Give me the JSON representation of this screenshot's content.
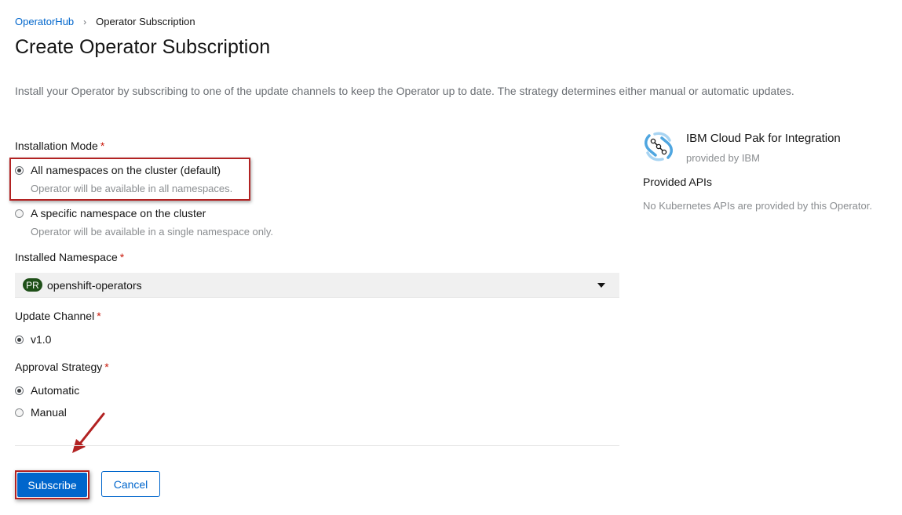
{
  "breadcrumb": {
    "parent": "OperatorHub",
    "separator": "›",
    "current": "Operator Subscription"
  },
  "page_title": "Create Operator Subscription",
  "intro": "Install your Operator by subscribing to one of the update channels to keep the Operator up to date. The strategy determines either manual or automatic updates.",
  "required_mark": "*",
  "installation_mode": {
    "label": "Installation Mode",
    "options": [
      {
        "label": "All namespaces on the cluster (default)",
        "help": "Operator will be available in all namespaces.",
        "checked": true
      },
      {
        "label": "A specific namespace on the cluster",
        "help": "Operator will be available in a single namespace only.",
        "checked": false
      }
    ]
  },
  "installed_namespace": {
    "label": "Installed Namespace",
    "badge": "PR",
    "value": "openshift-operators"
  },
  "update_channel": {
    "label": "Update Channel",
    "options": [
      {
        "label": "v1.0",
        "checked": true
      }
    ]
  },
  "approval_strategy": {
    "label": "Approval Strategy",
    "options": [
      {
        "label": "Automatic",
        "checked": true
      },
      {
        "label": "Manual",
        "checked": false
      }
    ]
  },
  "buttons": {
    "subscribe": "Subscribe",
    "cancel": "Cancel"
  },
  "operator": {
    "name": "IBM Cloud Pak for Integration",
    "provider": "provided by IBM",
    "provided_apis_title": "Provided APIs",
    "provided_apis_empty": "No Kubernetes APIs are provided by this Operator.",
    "logo_icon": "ibm-cloud-pak-integration-icon"
  },
  "colors": {
    "link": "#0066cc",
    "primary": "#0066cc",
    "required": "#c9190b",
    "annotation": "#b22222",
    "badge": "#1e4f18"
  }
}
